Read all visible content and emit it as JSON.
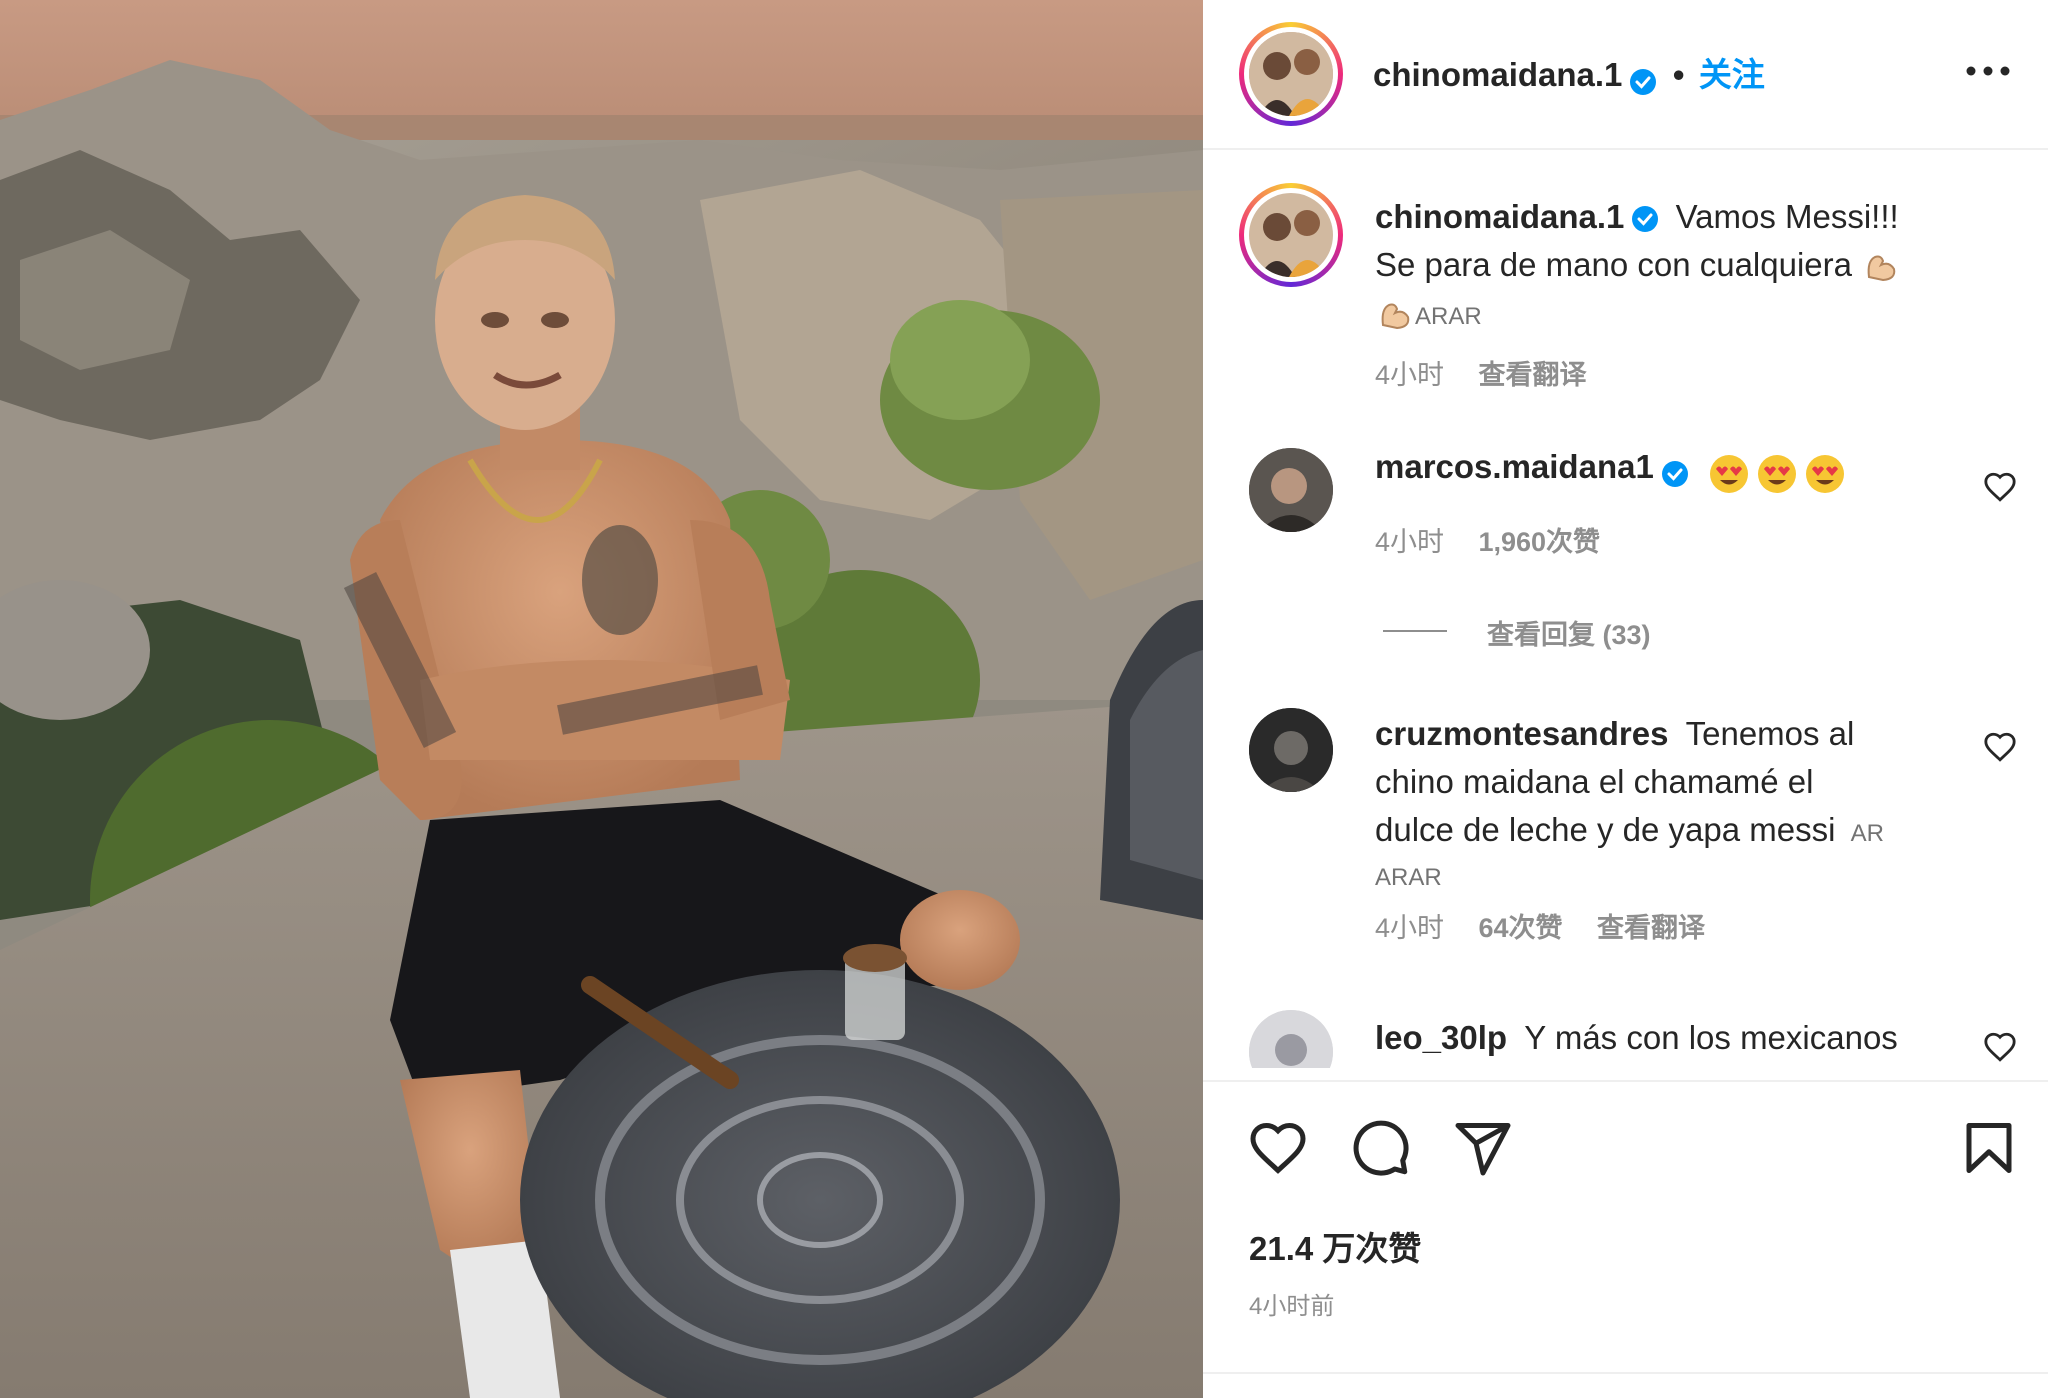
{
  "post": {
    "author": "chinomaidana.1",
    "follow_label": "关注",
    "dot": "•",
    "more_label": "···",
    "caption_author": "chinomaidana.1",
    "caption_line1": "Vamos Messi!!!",
    "caption_line2": "Se para de mano con cualquiera",
    "caption_flag": "ARAR",
    "caption_time": "4小时",
    "caption_translate": "查看翻译",
    "likes": "21.4 万次赞",
    "posted": "4小时前"
  },
  "comments": [
    {
      "user": "marcos.maidana1",
      "verified": true,
      "time": "4小时",
      "likes": "1,960次赞",
      "view_replies": "查看回复 (33)"
    },
    {
      "user": "cruzmontesandres",
      "text_line1": "Tenemos al",
      "text_line2": "chino maidana el chamamé el",
      "text_line3": "dulce de leche y de yapa messi",
      "flag1": "AR",
      "flag2": "ARAR",
      "time": "4小时",
      "likes": "64次赞",
      "translate": "查看翻译"
    },
    {
      "user": "leo_30lp",
      "text": "Y más con los mexicanos"
    }
  ],
  "icons": [
    "verified-badge-icon",
    "more-options-icon",
    "heart-icon",
    "comment-icon",
    "share-icon",
    "save-icon",
    "heart-eyes-emoji",
    "flexed-biceps-emoji"
  ],
  "colors": {
    "accent": "#0095f6",
    "text": "#262626",
    "muted": "#8e8e8e",
    "divider": "#efefef"
  }
}
